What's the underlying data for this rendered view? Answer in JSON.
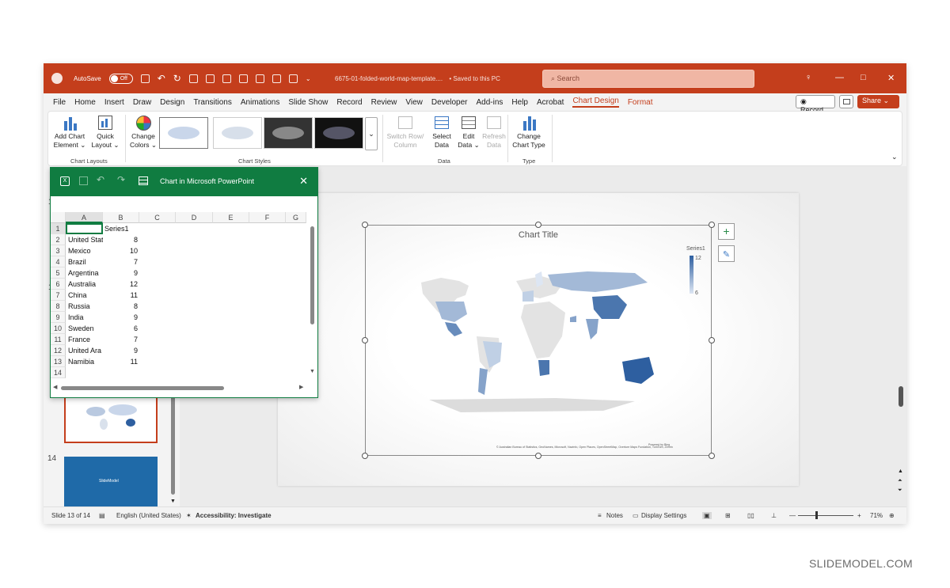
{
  "titlebar": {
    "autosave_label": "AutoSave",
    "autosave_state": "Off",
    "file_name": "6675-01-folded-world-map-template....",
    "save_status": "• Saved to this PC",
    "search_placeholder": "Search"
  },
  "menu": {
    "items": [
      "File",
      "Home",
      "Insert",
      "Draw",
      "Design",
      "Transitions",
      "Animations",
      "Slide Show",
      "Record",
      "Review",
      "View",
      "Developer",
      "Add-ins",
      "Help",
      "Acrobat",
      "Chart Design",
      "Format"
    ],
    "active": "Chart Design",
    "record_label": "Record",
    "share_label": "Share"
  },
  "ribbon": {
    "add_chart_element_1": "Add Chart",
    "add_chart_element_2": "Element",
    "quick_layout_1": "Quick",
    "quick_layout_2": "Layout",
    "change_colors_1": "Change",
    "change_colors_2": "Colors",
    "switch_row_1": "Switch Row/",
    "switch_row_2": "Column",
    "select_data_1": "Select",
    "select_data_2": "Data",
    "edit_data_1": "Edit",
    "edit_data_2": "Data",
    "refresh_data_1": "Refresh",
    "refresh_data_2": "Data",
    "change_type_1": "Change",
    "change_type_2": "Chart Type",
    "group_chart_layouts": "Chart Layouts",
    "group_chart_styles": "Chart Styles",
    "group_data": "Data",
    "group_type": "Type"
  },
  "excel": {
    "title": "Chart in Microsoft PowerPoint",
    "columns": [
      "A",
      "B",
      "C",
      "D",
      "E",
      "F",
      "G"
    ],
    "rows": [
      "1",
      "2",
      "3",
      "4",
      "5",
      "6",
      "7",
      "8",
      "9",
      "10",
      "11",
      "12",
      "13",
      "14"
    ],
    "header_b": "Series1",
    "countries": [
      "United Stat",
      "Mexico",
      "Brazil",
      "Argentina",
      "Australia",
      "China",
      "Russia",
      "India",
      "Sweden",
      "France",
      "United Ara",
      "Namibia"
    ],
    "values": [
      "8",
      "10",
      "7",
      "9",
      "12",
      "11",
      "8",
      "9",
      "6",
      "7",
      "9",
      "11"
    ]
  },
  "slides": {
    "partial_number": "1",
    "thumb_number": "14",
    "thumb_label": "SlideModel"
  },
  "chart": {
    "title": "Chart Title",
    "legend_title": "Series1",
    "legend_max": "12",
    "legend_min": "6",
    "powered_by": "Powered by Bing",
    "attribution": "© Australian Bureau of Statistics, GeoNames, Microsoft, Navinfo, Open Places, OpenStreetMap, Overture Maps Fundation, TomTom, Zenrin"
  },
  "chart_data": {
    "type": "map",
    "title": "Chart Title",
    "series": [
      {
        "name": "Series1",
        "values": [
          8,
          10,
          7,
          9,
          12,
          11,
          8,
          9,
          6,
          7,
          9,
          11
        ]
      }
    ],
    "categories": [
      "United States",
      "Mexico",
      "Brazil",
      "Argentina",
      "Australia",
      "China",
      "Russia",
      "India",
      "Sweden",
      "France",
      "United Arab Emirates",
      "Namibia"
    ],
    "legend_range": [
      6,
      12
    ]
  },
  "status": {
    "slide_info": "Slide 13 of 14",
    "language": "English (United States)",
    "accessibility": "Accessibility: Investigate",
    "notes": "Notes",
    "display_settings": "Display Settings",
    "zoom": "71%"
  },
  "watermark": "SLIDEMODEL.COM",
  "colors": {
    "accent": "#c43e1c",
    "excel": "#107c41",
    "map_dark": "#2e5fa0",
    "map_light": "#dde6f3"
  }
}
